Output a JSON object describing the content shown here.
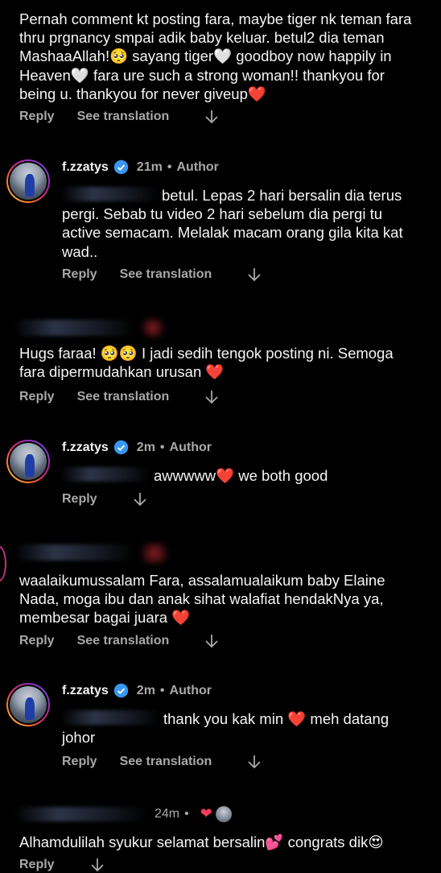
{
  "actions": {
    "reply": "Reply",
    "see_translation": "See translation"
  },
  "comments": [
    {
      "text": "Pernah comment kt posting fara, maybe tiger nk teman fara thru prgnancy smpai adik baby keluar. betul2 dia teman MashaaAllah!🥺 sayang tiger🤍 goodboy now happily in Heaven🤍 fara ure such a strong woman!! thankyou for being u. thankyou for never giveup❤️"
    },
    {
      "username": "f.zzatys",
      "time": "21m",
      "role": "Author",
      "text": "betul. Lepas 2 hari bersalin dia terus pergi. Sebab tu video 2 hari sebelum dia pergi tu active semacam. Melalak macam orang gila kita kat wad.."
    },
    {
      "text": "Hugs faraa! 🥺🥺 I jadi sedih tengok posting ni. Semoga fara dipermudahkan urusan ❤️"
    },
    {
      "username": "f.zzatys",
      "time": "2m",
      "role": "Author",
      "text": "awwwww❤️ we both good"
    },
    {
      "text": "waalaikumussalam Fara, assalamualaikum baby Elaine Nada, moga ibu dan anak sihat walafiat hendakNya ya, membesar bagai juara ❤️"
    },
    {
      "username": "f.zzatys",
      "time": "2m",
      "role": "Author",
      "text": "thank you kak min ❤️ meh datang johor"
    },
    {
      "time": "24m",
      "text": "Alhamdulilah syukur selamat bersalin💕 congrats dik😍"
    }
  ],
  "separator": "•",
  "colors": {
    "background": "#000000",
    "text": "#f5f5f5",
    "secondary": "#a8a8a8",
    "verified": "#3897f0",
    "heart": "#ff3b5c"
  }
}
